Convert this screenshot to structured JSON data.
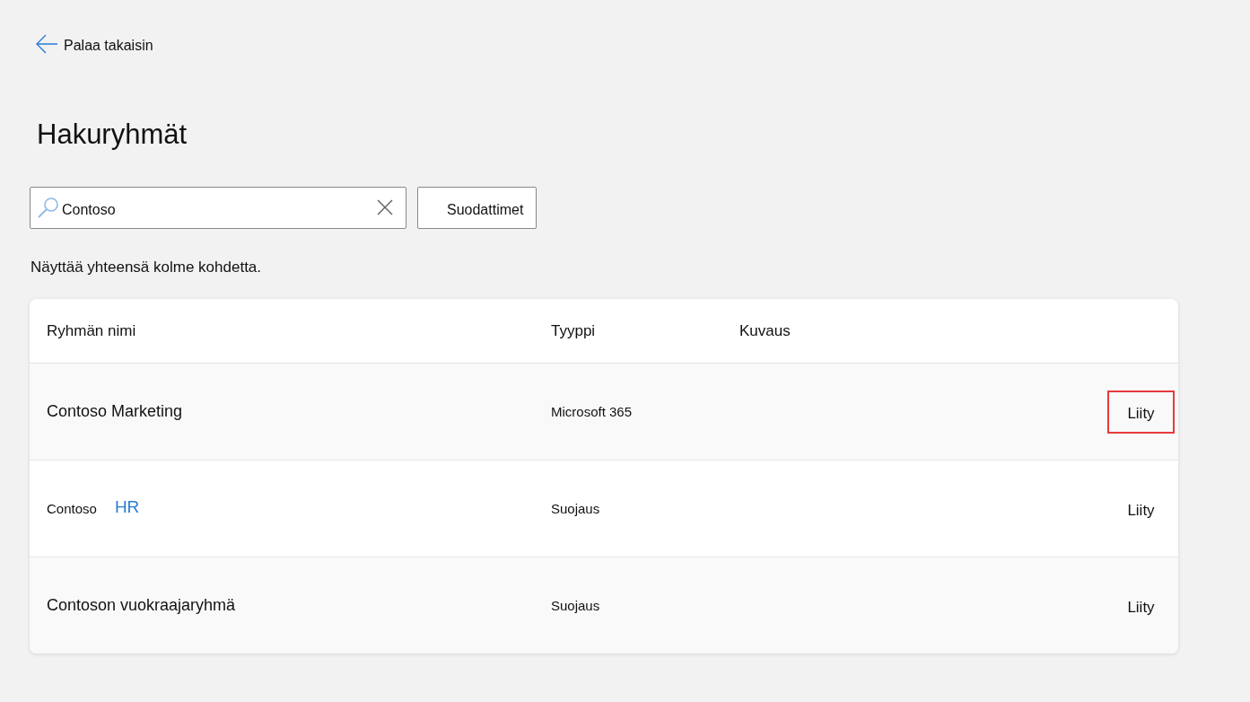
{
  "back_link": {
    "label": "Palaa takaisin"
  },
  "title": "Hakuryhmät",
  "search": {
    "value": "Contoso"
  },
  "filter_button": {
    "label": "Suodattimet"
  },
  "result_summary": "Näyttää yhteensä kolme kohdetta.",
  "table": {
    "columns": [
      "Ryhmän nimi",
      "Tyyppi",
      "Kuvaus"
    ],
    "rows": [
      {
        "name": [
          {
            "kind": "text",
            "text": "Contoso Marketing"
          }
        ],
        "type": "Microsoft 365",
        "action": {
          "label": "Liity",
          "highlighted": true
        }
      },
      {
        "name": [
          {
            "kind": "small",
            "text": "Contoso"
          },
          {
            "kind": "link",
            "text": "HR"
          }
        ],
        "type": "Suojaus",
        "action": {
          "label": "Liity",
          "highlighted": false
        }
      },
      {
        "name": [
          {
            "kind": "text",
            "text": "Contoson vuokraajaryhmä"
          }
        ],
        "type": "Suojaus",
        "action": {
          "label": "Liity",
          "highlighted": false
        }
      }
    ]
  }
}
